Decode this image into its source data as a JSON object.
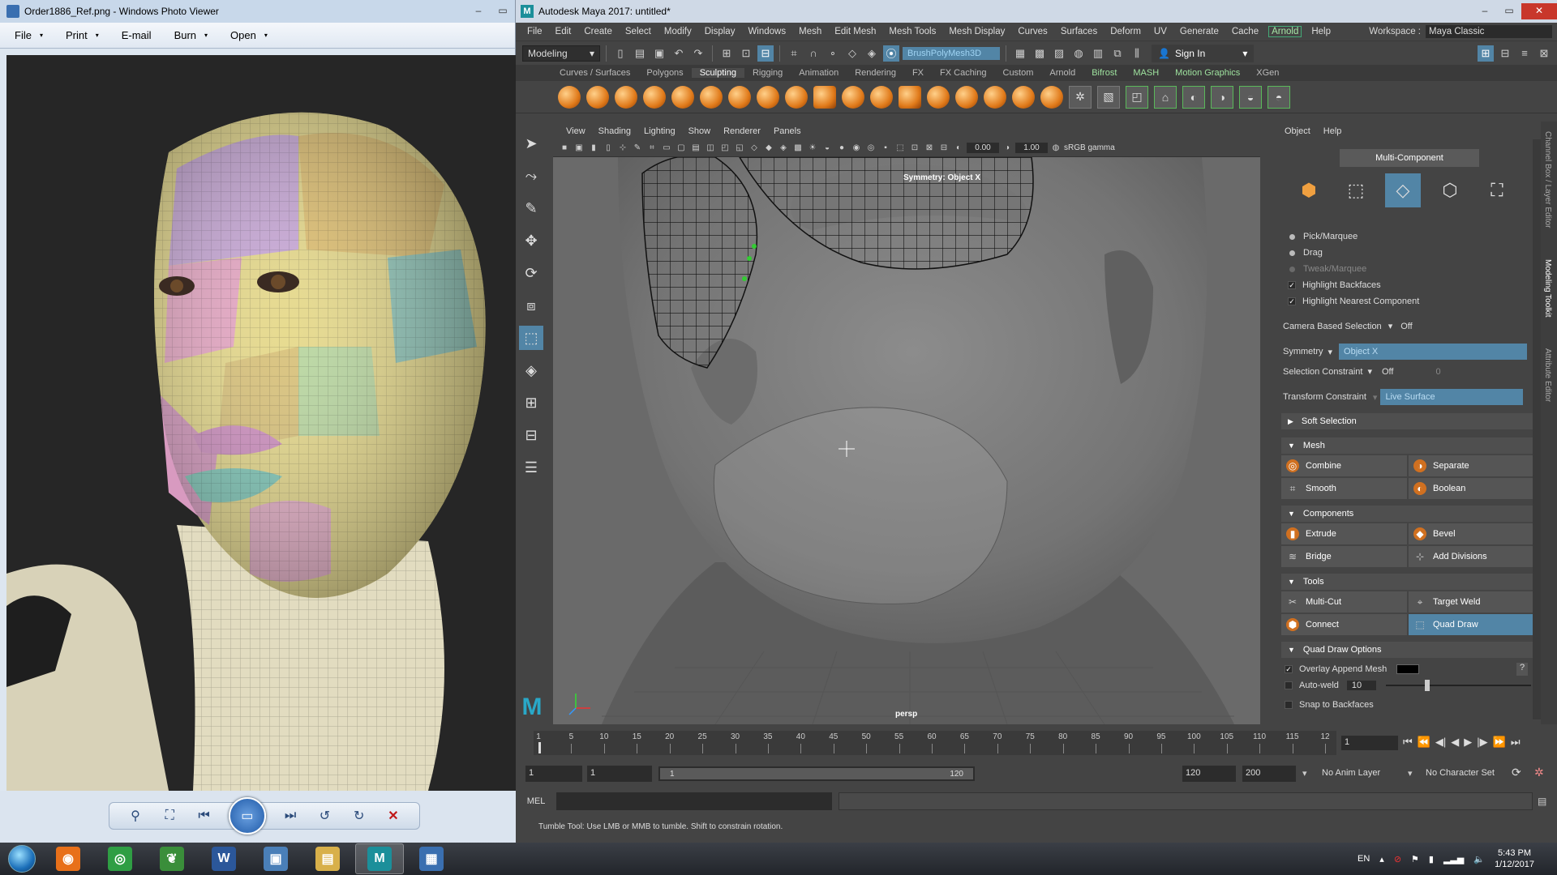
{
  "photo_viewer": {
    "title": "Order1886_Ref.png - Windows Photo Viewer",
    "menu": [
      {
        "label": "File",
        "arrow": "▾"
      },
      {
        "label": "Print",
        "arrow": "▾"
      },
      {
        "label": "E-mail",
        "arrow": ""
      },
      {
        "label": "Burn",
        "arrow": "▾"
      },
      {
        "label": "Open",
        "arrow": "▾"
      }
    ],
    "window_buttons": [
      "–",
      "▭"
    ]
  },
  "maya": {
    "title": "Autodesk Maya 2017: untitled*",
    "window_buttons": [
      "–",
      "▭",
      "✕"
    ],
    "menu": [
      "File",
      "Edit",
      "Create",
      "Select",
      "Modify",
      "Display",
      "Windows",
      "Mesh",
      "Edit Mesh",
      "Mesh Tools",
      "Mesh Display",
      "Curves",
      "Surfaces",
      "Deform",
      "UV",
      "Generate",
      "Cache"
    ],
    "menu_arnold": "Arnold",
    "menu_help": "Help",
    "workspace_label": "Workspace :",
    "workspace_value": "Maya Classic",
    "mode_dropdown": "Modeling",
    "name_field": "BrushPolyMesh3D",
    "sign_in": "Sign In",
    "shelf_tabs": [
      "Curves / Surfaces",
      "Polygons",
      "Sculpting",
      "Rigging",
      "Animation",
      "Rendering",
      "FX",
      "FX Caching",
      "Custom",
      "Arnold",
      "Bifrost",
      "MASH",
      "Motion Graphics",
      "XGen"
    ],
    "shelf_active": "Sculpting",
    "shelf_bracketed": [
      "Bifrost",
      "MASH",
      "Motion Graphics"
    ],
    "viewport": {
      "menu": [
        "View",
        "Shading",
        "Lighting",
        "Show",
        "Renderer",
        "Panels"
      ],
      "field1": "0.00",
      "field2": "1.00",
      "color_space": "sRGB gamma",
      "symmetry_label": "Symmetry: Object X",
      "camera": "persp"
    },
    "toolkit": {
      "menu": [
        "Object",
        "Help"
      ],
      "multi_component": "Multi-Component",
      "pick_marquee": "Pick/Marquee",
      "drag": "Drag",
      "tweak_marquee": "Tweak/Marquee",
      "highlight_backfaces": "Highlight Backfaces",
      "highlight_nearest": "Highlight Nearest Component",
      "camera_based_label": "Camera Based Selection",
      "camera_based_value": "Off",
      "symmetry_label": "Symmetry",
      "symmetry_value": "Object X",
      "selection_constraint_label": "Selection Constraint",
      "selection_constraint_value": "Off",
      "selection_constraint_num": "0",
      "transform_constraint_label": "Transform Constraint",
      "transform_constraint_value": "Live Surface",
      "soft_selection": "Soft Selection",
      "mesh_section": "Mesh",
      "combine": "Combine",
      "separate": "Separate",
      "smooth": "Smooth",
      "boolean": "Boolean",
      "components_section": "Components",
      "extrude": "Extrude",
      "bevel": "Bevel",
      "bridge": "Bridge",
      "add_divisions": "Add Divisions",
      "tools_section": "Tools",
      "multi_cut": "Multi-Cut",
      "target_weld": "Target Weld",
      "connect": "Connect",
      "quad_draw": "Quad Draw",
      "quad_draw_options": "Quad Draw Options",
      "overlay_append": "Overlay Append Mesh",
      "auto_weld": "Auto-weld",
      "auto_weld_value": "10",
      "snap_backfaces": "Snap to Backfaces",
      "help_btn": "?"
    },
    "side_tabs": [
      "Channel Box / Layer Editor",
      "Modeling Toolkit",
      "Attribute Editor"
    ],
    "timeline": {
      "ticks": [
        "1",
        "5",
        "10",
        "15",
        "20",
        "25",
        "30",
        "35",
        "40",
        "45",
        "50",
        "55",
        "60",
        "65",
        "70",
        "75",
        "80",
        "85",
        "90",
        "95",
        "100",
        "105",
        "110",
        "115",
        "12"
      ],
      "current_frame": "1"
    },
    "range": {
      "start": "1",
      "start2": "1",
      "slider_start": "1",
      "slider_end": "120",
      "end": "120",
      "end2": "200",
      "anim_layer": "No Anim Layer",
      "char_set": "No Character Set"
    },
    "command_label": "MEL",
    "help_line": "Tumble Tool: Use LMB or MMB to tumble. Shift to constrain rotation."
  },
  "taskbar": {
    "lang": "EN",
    "time": "5:43 PM",
    "date": "1/12/2017",
    "apps": [
      {
        "name": "firefox",
        "color": "#e8701a",
        "glyph": "◉"
      },
      {
        "name": "chrome",
        "color": "#2f9e44",
        "glyph": "◎"
      },
      {
        "name": "evernote",
        "color": "#3a8e3a",
        "glyph": "❦"
      },
      {
        "name": "word",
        "color": "#2b579a",
        "glyph": "W"
      },
      {
        "name": "remote",
        "color": "#4a7fb8",
        "glyph": "▣"
      },
      {
        "name": "explorer",
        "color": "#d8b04a",
        "glyph": "▤"
      },
      {
        "name": "maya",
        "color": "#1b8f9a",
        "glyph": "M"
      },
      {
        "name": "photoviewer",
        "color": "#3a6fb0",
        "glyph": "▦"
      }
    ]
  }
}
